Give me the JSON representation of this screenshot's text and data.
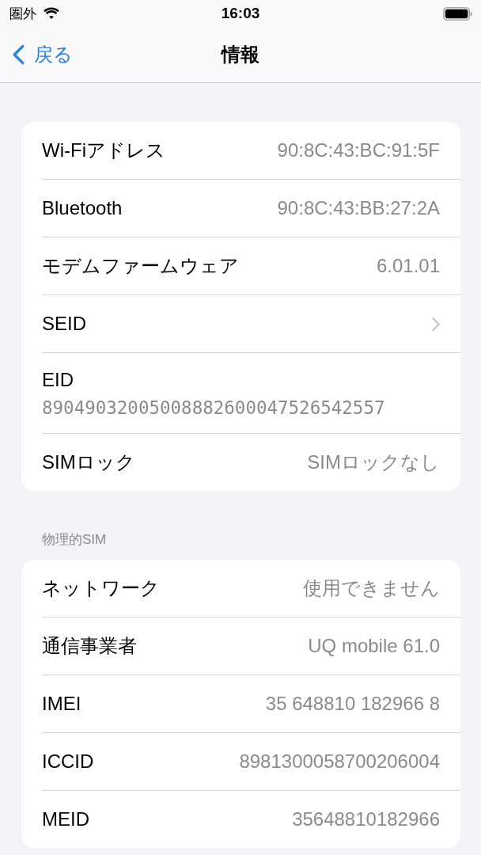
{
  "status_bar": {
    "carrier": "圏外",
    "time": "16:03"
  },
  "nav": {
    "back": "戻る",
    "title": "情報"
  },
  "sections": [
    {
      "rows": [
        {
          "kind": "value",
          "label": "Wi-Fiアドレス",
          "value": "90:8C:43:BC:91:5F"
        },
        {
          "kind": "value",
          "label": "Bluetooth",
          "value": "90:8C:43:BB:27:2A"
        },
        {
          "kind": "value",
          "label": "モデムファームウェア",
          "value": "6.01.01"
        },
        {
          "kind": "chevron",
          "label": "SEID"
        },
        {
          "kind": "stacked",
          "label": "EID",
          "value": "89049032005008882600047526542557"
        },
        {
          "kind": "value",
          "label": "SIMロック",
          "value": "SIMロックなし"
        }
      ]
    },
    {
      "header": "物理的SIM",
      "rows": [
        {
          "kind": "value",
          "label": "ネットワーク",
          "value": "使用できません"
        },
        {
          "kind": "value",
          "label": "通信事業者",
          "value": "UQ mobile 61.0"
        },
        {
          "kind": "value",
          "label": "IMEI",
          "value": "35 648810 182966 8"
        },
        {
          "kind": "value",
          "label": "ICCID",
          "value": "8981300058700206004"
        },
        {
          "kind": "value",
          "label": "MEID",
          "value": "35648810182966"
        }
      ]
    }
  ]
}
